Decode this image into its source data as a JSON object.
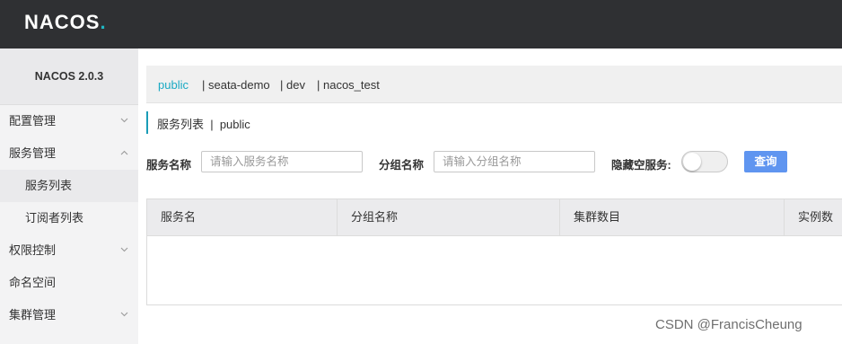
{
  "header": {
    "logo": "NACOS",
    "logo_dot": "."
  },
  "sidebar": {
    "version": "NACOS 2.0.3",
    "items": [
      {
        "label": "配置管理",
        "chevron": "down"
      },
      {
        "label": "服务管理",
        "chevron": "up"
      },
      {
        "label": "服务列表",
        "sub": true,
        "active": true
      },
      {
        "label": "订阅者列表",
        "sub": true
      },
      {
        "label": "权限控制",
        "chevron": "down"
      },
      {
        "label": "命名空间"
      },
      {
        "label": "集群管理",
        "chevron": "down"
      }
    ]
  },
  "namespaces": {
    "tabs": [
      {
        "label": "public",
        "active": true
      },
      {
        "label": "| seata-demo"
      },
      {
        "label": "| dev"
      },
      {
        "label": "| nacos_test"
      }
    ]
  },
  "breadcrumb": {
    "text": "服务列表  |  public"
  },
  "filters": {
    "service_name_label": "服务名称",
    "service_name_placeholder": "请输入服务名称",
    "group_name_label": "分组名称",
    "group_name_placeholder": "请输入分组名称",
    "hide_empty_label": "隐藏空服务:",
    "hide_empty_on": false,
    "query_button": "查询"
  },
  "table": {
    "columns": [
      "服务名",
      "分组名称",
      "集群数目",
      "实例数"
    ],
    "rows": []
  },
  "watermark": "CSDN @FrancisCheung",
  "colors": {
    "topbar": "#2f3033",
    "accent": "#1fb6c3",
    "button": "#5f95f0",
    "sidebar_bg": "#f3f3f4"
  }
}
